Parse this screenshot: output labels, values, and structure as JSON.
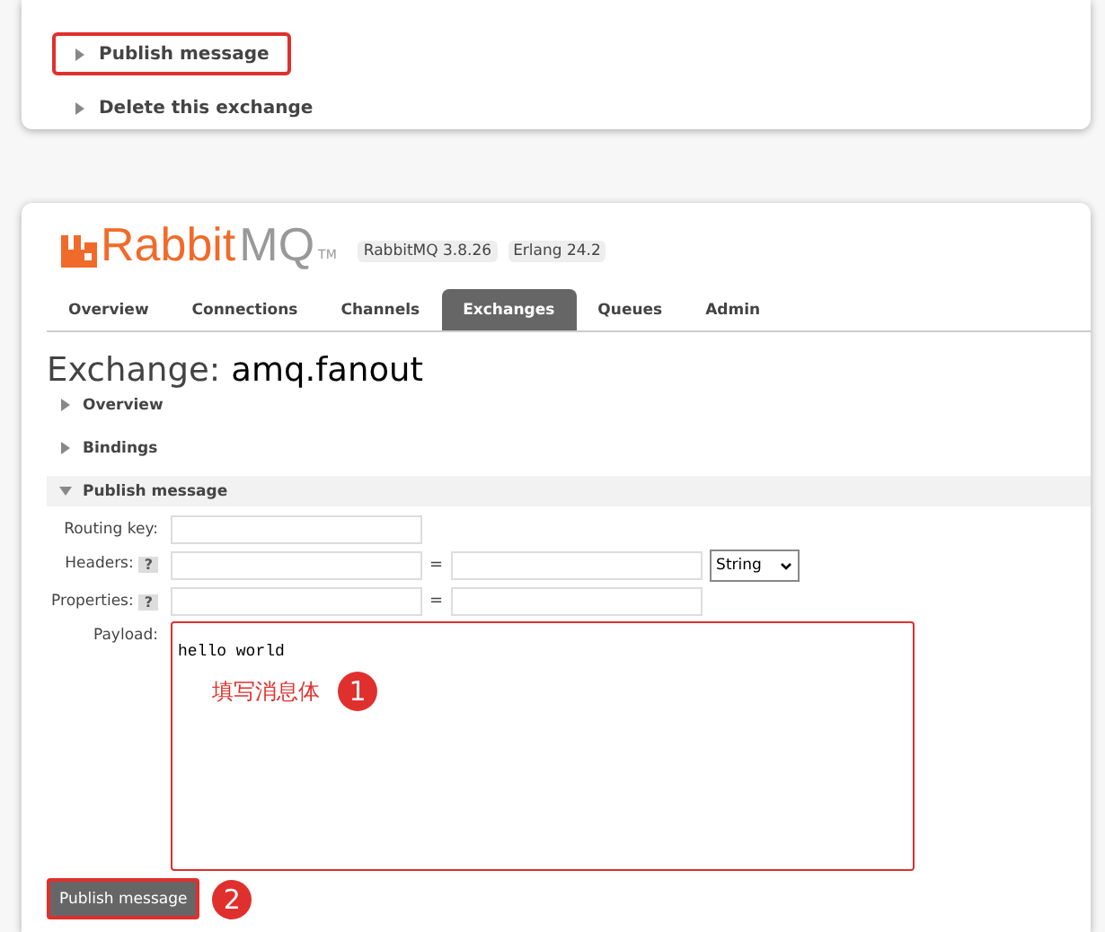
{
  "top_panel": {
    "sections": [
      {
        "label": "Publish message",
        "expanded": false,
        "highlighted": true
      },
      {
        "label": "Delete this exchange",
        "expanded": false,
        "highlighted": false
      }
    ]
  },
  "header": {
    "logo_primary": "Rabbit",
    "logo_secondary": "MQ",
    "trademark": "TM",
    "badges": [
      "RabbitMQ 3.8.26",
      "Erlang 24.2"
    ]
  },
  "tabs": [
    {
      "label": "Overview",
      "selected": false
    },
    {
      "label": "Connections",
      "selected": false
    },
    {
      "label": "Channels",
      "selected": false
    },
    {
      "label": "Exchanges",
      "selected": true
    },
    {
      "label": "Queues",
      "selected": false
    },
    {
      "label": "Admin",
      "selected": false
    }
  ],
  "page_title": {
    "prefix": "Exchange:",
    "name": "amq.fanout"
  },
  "sections": [
    {
      "label": "Overview",
      "expanded": false
    },
    {
      "label": "Bindings",
      "expanded": false
    },
    {
      "label": "Publish message",
      "expanded": true
    }
  ],
  "form": {
    "routing_key": {
      "label": "Routing key:"
    },
    "headers": {
      "label": "Headers:",
      "help": "?",
      "separator": "=",
      "type": "String"
    },
    "properties": {
      "label": "Properties:",
      "help": "?",
      "separator": "="
    },
    "payload": {
      "label": "Payload:",
      "value": "hello world",
      "highlighted": true
    }
  },
  "annotations": [
    {
      "text": "填写消息体",
      "number": "1"
    },
    {
      "number": "2"
    }
  ],
  "publish_button": {
    "label": "Publish message",
    "highlighted": true
  }
}
